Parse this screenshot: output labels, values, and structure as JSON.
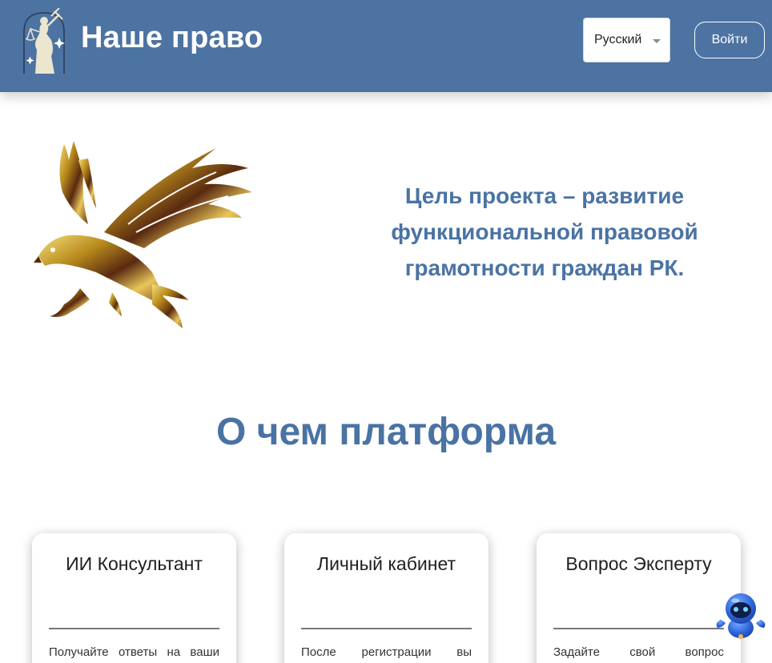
{
  "header": {
    "brand": "Наше право",
    "language_selected": "Русский",
    "login_label": "Войти"
  },
  "hero": {
    "goal_lines": [
      "Цель проекта – развитие",
      "функциональной правовой",
      "грамотности граждан РК."
    ]
  },
  "about": {
    "title": "О чем платформа",
    "cards": [
      {
        "title": "ИИ Консультант",
        "text": "Получайте ответы на ваши"
      },
      {
        "title": "Личный кабинет",
        "text": "После регистрации вы"
      },
      {
        "title": "Вопрос Эксперту",
        "text": "Задайте свой вопрос"
      }
    ]
  },
  "colors": {
    "header_bg": "#4c73a2",
    "accent_text": "#4a73a4",
    "eagle_gold": "#c9a227"
  },
  "icons": {
    "logo": "themis-statue-icon",
    "hero": "golden-eagle-illustration",
    "assistant": "robot-assistant-icon"
  }
}
